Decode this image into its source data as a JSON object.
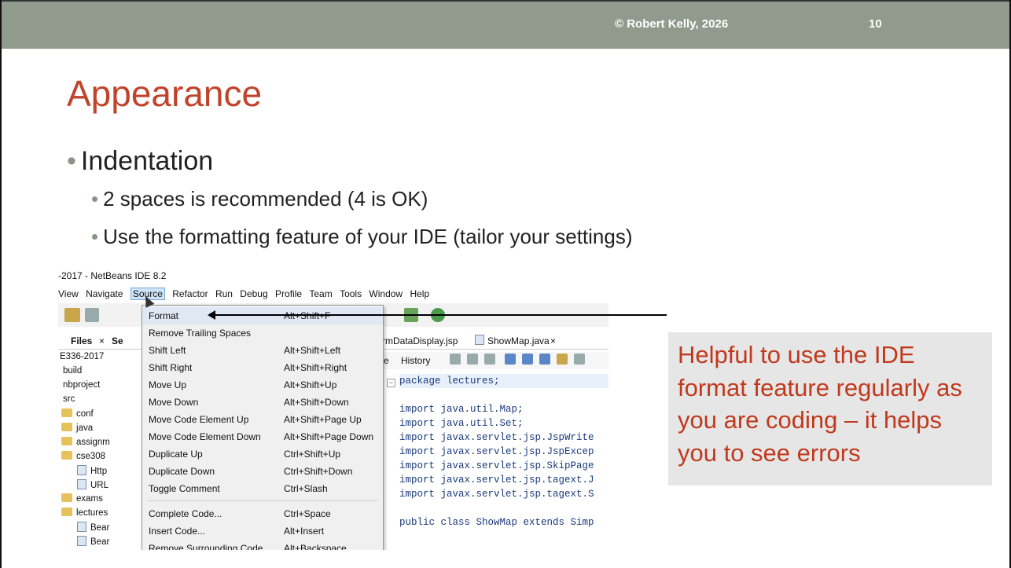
{
  "header": {
    "copyright": "© Robert Kelly, 2026",
    "page_number": "10"
  },
  "title": "Appearance",
  "bullets": {
    "main": "Indentation",
    "sub1": "2 spaces is recommended (4 is OK)",
    "sub2": "Use the formatting feature of your IDE (tailor your settings)"
  },
  "callout": "Helpful to use the IDE format feature regularly as you are coding – it helps you to see errors",
  "ide": {
    "window_title": "-2017 - NetBeans IDE 8.2",
    "menubar": [
      "View",
      "Navigate",
      "Source",
      "Refactor",
      "Run",
      "Debug",
      "Profile",
      "Team",
      "Tools",
      "Window",
      "Help"
    ],
    "left_tabs": {
      "files": "Files",
      "close": "×",
      "se": "Se"
    },
    "tree": [
      {
        "label": "E336-2017",
        "kind": "none"
      },
      {
        "label": "build",
        "kind": "none"
      },
      {
        "label": "nbproject",
        "kind": "none"
      },
      {
        "label": "src",
        "kind": "none"
      },
      {
        "label": "conf",
        "kind": "folder"
      },
      {
        "label": "java",
        "kind": "folder"
      },
      {
        "label": "assignm",
        "kind": "folder"
      },
      {
        "label": "cse308",
        "kind": "folder"
      },
      {
        "label": "Http",
        "kind": "file"
      },
      {
        "label": "URL",
        "kind": "file"
      },
      {
        "label": "exams",
        "kind": "folder"
      },
      {
        "label": "lectures",
        "kind": "folder"
      },
      {
        "label": "Bear",
        "kind": "file"
      },
      {
        "label": "Bear",
        "kind": "file"
      }
    ],
    "source_menu": [
      {
        "label": "Format",
        "shortcut": "Alt+Shift+F"
      },
      {
        "label": "Remove Trailing Spaces",
        "shortcut": ""
      },
      {
        "label": "Shift Left",
        "shortcut": "Alt+Shift+Left"
      },
      {
        "label": "Shift Right",
        "shortcut": "Alt+Shift+Right"
      },
      {
        "label": "Move Up",
        "shortcut": "Alt+Shift+Up"
      },
      {
        "label": "Move Down",
        "shortcut": "Alt+Shift+Down"
      },
      {
        "label": "Move Code Element Up",
        "shortcut": "Alt+Shift+Page Up"
      },
      {
        "label": "Move Code Element Down",
        "shortcut": "Alt+Shift+Page Down"
      },
      {
        "label": "Duplicate Up",
        "shortcut": "Ctrl+Shift+Up"
      },
      {
        "label": "Duplicate Down",
        "shortcut": "Ctrl+Shift+Down"
      },
      {
        "label": "Toggle Comment",
        "shortcut": "Ctrl+Slash"
      },
      {
        "label": "Complete Code...",
        "shortcut": "Ctrl+Space"
      },
      {
        "label": "Insert Code...",
        "shortcut": "Alt+Insert"
      },
      {
        "label": "Remove Surrounding Code",
        "shortcut": "Alt+Backspace"
      }
    ],
    "code_tabs": {
      "tab1": "rmDataDisplay.jsp",
      "tab2": "ShowMap.java",
      "close": "×"
    },
    "code_toolbar": {
      "e": "e",
      "history": "History"
    },
    "code": [
      "package lectures;",
      "",
      "import java.util.Map;",
      "import java.util.Set;",
      "import javax.servlet.jsp.JspWrite",
      "import javax.servlet.jsp.JspExcep",
      "import javax.servlet.jsp.SkipPage",
      "import javax.servlet.jsp.tagext.J",
      "import javax.servlet.jsp.tagext.S",
      "",
      "public class ShowMap extends Simp"
    ]
  }
}
